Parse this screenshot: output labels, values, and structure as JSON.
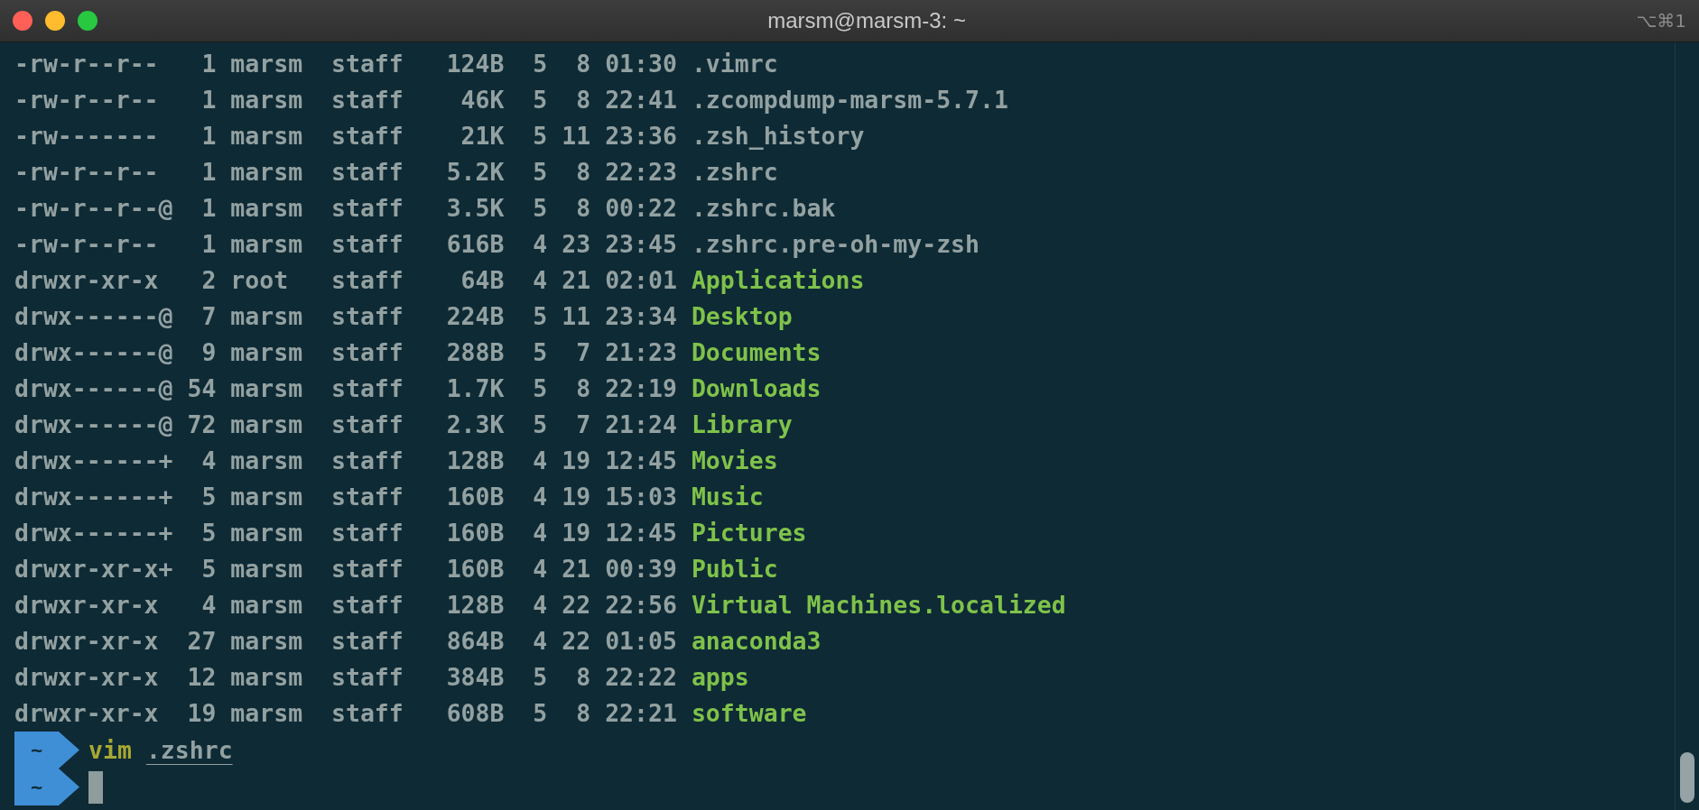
{
  "window": {
    "title": "marsm@marsm-3: ~",
    "shortcut": "⌥⌘1"
  },
  "listing": [
    {
      "kind": "file",
      "meta": "-rw-r--r--   1 marsm  staff   124B  5  8 01:30",
      "name": ".vimrc"
    },
    {
      "kind": "file",
      "meta": "-rw-r--r--   1 marsm  staff    46K  5  8 22:41",
      "name": ".zcompdump-marsm-5.7.1"
    },
    {
      "kind": "file",
      "meta": "-rw-------   1 marsm  staff    21K  5 11 23:36",
      "name": ".zsh_history"
    },
    {
      "kind": "file",
      "meta": "-rw-r--r--   1 marsm  staff   5.2K  5  8 22:23",
      "name": ".zshrc"
    },
    {
      "kind": "file",
      "meta": "-rw-r--r--@  1 marsm  staff   3.5K  5  8 00:22",
      "name": ".zshrc.bak"
    },
    {
      "kind": "file",
      "meta": "-rw-r--r--   1 marsm  staff   616B  4 23 23:45",
      "name": ".zshrc.pre-oh-my-zsh"
    },
    {
      "kind": "dir",
      "meta": "drwxr-xr-x   2 root   staff    64B  4 21 02:01",
      "name": "Applications"
    },
    {
      "kind": "dir",
      "meta": "drwx------@  7 marsm  staff   224B  5 11 23:34",
      "name": "Desktop"
    },
    {
      "kind": "dir",
      "meta": "drwx------@  9 marsm  staff   288B  5  7 21:23",
      "name": "Documents"
    },
    {
      "kind": "dir",
      "meta": "drwx------@ 54 marsm  staff   1.7K  5  8 22:19",
      "name": "Downloads"
    },
    {
      "kind": "dir",
      "meta": "drwx------@ 72 marsm  staff   2.3K  5  7 21:24",
      "name": "Library"
    },
    {
      "kind": "dir",
      "meta": "drwx------+  4 marsm  staff   128B  4 19 12:45",
      "name": "Movies"
    },
    {
      "kind": "dir",
      "meta": "drwx------+  5 marsm  staff   160B  4 19 15:03",
      "name": "Music"
    },
    {
      "kind": "dir",
      "meta": "drwx------+  5 marsm  staff   160B  4 19 12:45",
      "name": "Pictures"
    },
    {
      "kind": "dir",
      "meta": "drwxr-xr-x+  5 marsm  staff   160B  4 21 00:39",
      "name": "Public"
    },
    {
      "kind": "dir",
      "meta": "drwxr-xr-x   4 marsm  staff   128B  4 22 22:56",
      "name": "Virtual Machines.localized"
    },
    {
      "kind": "dir",
      "meta": "drwxr-xr-x  27 marsm  staff   864B  4 22 01:05",
      "name": "anaconda3"
    },
    {
      "kind": "dir",
      "meta": "drwxr-xr-x  12 marsm  staff   384B  5  8 22:22",
      "name": "apps"
    },
    {
      "kind": "dir",
      "meta": "drwxr-xr-x  19 marsm  staff   608B  5  8 22:21",
      "name": "software"
    }
  ],
  "prompts": [
    {
      "dir": "~",
      "command": "vim",
      "argument": ".zshrc",
      "cursor": false
    },
    {
      "dir": "~",
      "cursor": true
    }
  ]
}
